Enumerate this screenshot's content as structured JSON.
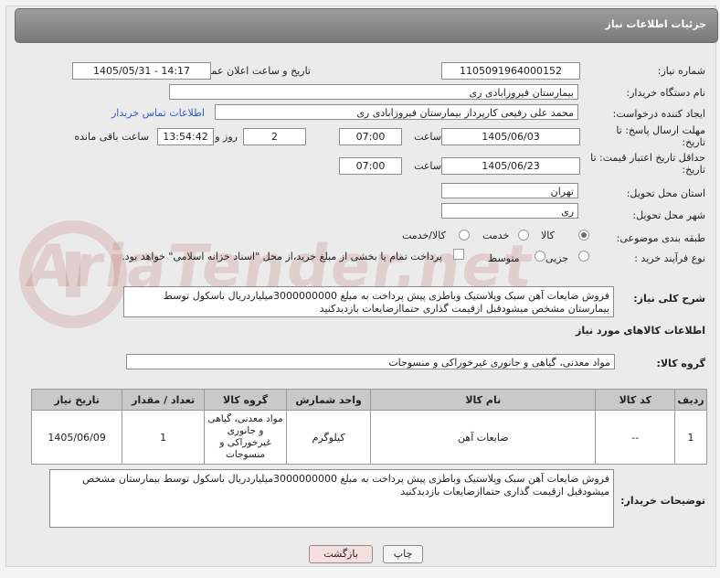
{
  "header": {
    "title": "جزئیات اطلاعات نیاز"
  },
  "fields": {
    "need_number_label": "شماره نیاز:",
    "need_number": "1105091964000152",
    "announce_label": "تاریخ و ساعت اعلان عمومی:",
    "announce_value": "1405/05/31 - 14:17",
    "buyer_org_label": "نام دستگاه خریدار:",
    "buyer_org": "بیمارستان فیروزابادی ری",
    "creator_label": "ایجاد کننده درخواست:",
    "creator": "محمد علی رفیعی کارپرداز بیمارستان فیروزابادی ری",
    "contact_link": "اطلاعات تماس خریدار",
    "reply_deadline_label": "مهلت ارسال پاسخ: تا تاریخ:",
    "reply_date": "1405/06/03",
    "time_label": "ساعت",
    "reply_time": "07:00",
    "days_value": "2",
    "days_label": "روز و",
    "remaining_time": "13:54:42",
    "remaining_label": "ساعت باقی مانده",
    "validity_label": "حداقل تاریخ اعتبار قیمت: تا تاریخ:",
    "validity_date": "1405/06/23",
    "validity_time": "07:00",
    "province_label": "استان محل تحویل:",
    "province": "تهران",
    "city_label": "شهر محل تحویل:",
    "city": "ری",
    "category_label": "طبقه بندی موضوعی:",
    "category_options": [
      "کالا",
      "خدمت",
      "کالا/خدمت"
    ],
    "process_label": "نوع فرآیند خرید :",
    "process_options": [
      "جزیی",
      "متوسط"
    ],
    "payment_note": "پرداخت تمام یا بخشی از مبلغ خرید،از محل \"اسناد خزانه اسلامی\" خواهد بود.",
    "general_desc_label": "شرح کلی نیاز:",
    "general_desc": "فروش ضایعات آهن سبک وپلاستیک وباطری پیش پرداخت به مبلغ 3000000000میلیاردریال باسکول توسط بیمارستان مشخص میشودقبل ازقیمت گذاری حتماازضایعات بازدیدکنید"
  },
  "goods": {
    "section_title": "اطلاعات کالاهای مورد نیاز",
    "group_label": "گروه کالا:",
    "group_value": "مواد معدنی، گیاهی و جانوری غیرخوراکی و منسوجات",
    "columns": [
      "ردیف",
      "کد کالا",
      "نام کالا",
      "واحد شمارش",
      "گروه کالا",
      "تعداد / مقدار",
      "تاریخ نیاز"
    ],
    "rows": [
      {
        "row": "1",
        "code": "--",
        "name": "ضایعات آهن",
        "unit": "کیلوگرم",
        "group": "مواد معدنی، گیاهی و جانوری غیرخوراکی و منسوجات",
        "qty": "1",
        "date": "1405/06/09"
      }
    ]
  },
  "buyer_notes": {
    "label": "توضیحات خریدار:",
    "text": "فروش ضایعات آهن سبک وپلاستیک وباطری پیش پرداخت به مبلغ 3000000000میلیاردریال باسکول توسط بیمارستان مشخص میشودقبل ازقیمت گذاری حتماازضایعات بازدیدکنید"
  },
  "buttons": {
    "print": "چاپ",
    "back": "بازگشت"
  },
  "watermark": {
    "text": "AriaTender.net"
  },
  "colors": {
    "link": "#2b5dcf",
    "title_bar": "#8a8a8a",
    "back_button": "#f6dede"
  }
}
